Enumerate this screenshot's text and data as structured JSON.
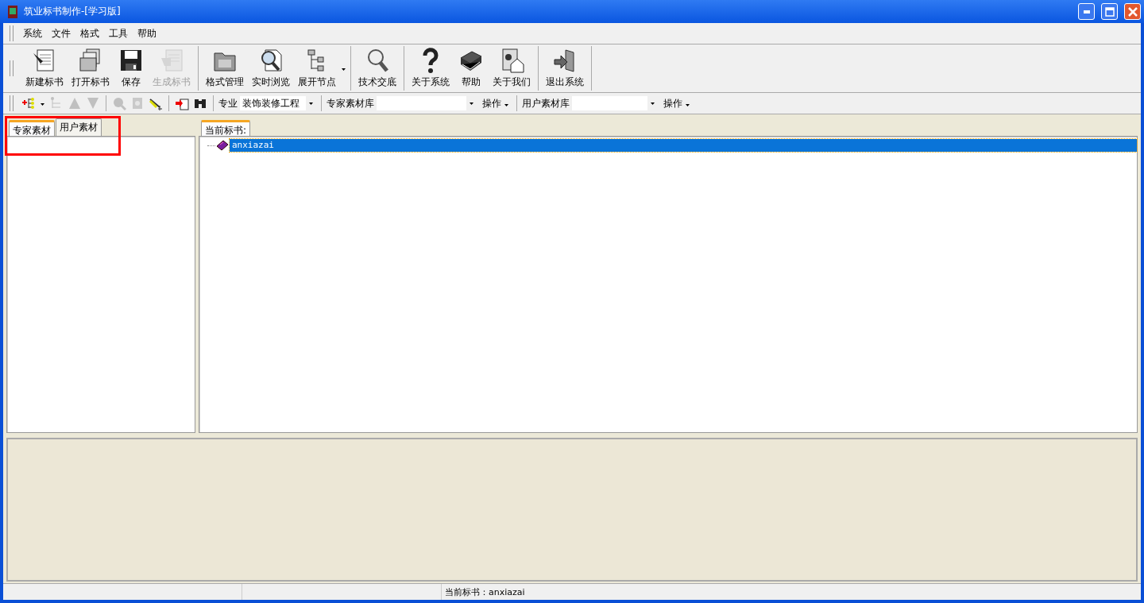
{
  "window": {
    "title": "筑业标书制作-[学习版]"
  },
  "menu": [
    "系统",
    "文件",
    "格式",
    "工具",
    "帮助"
  ],
  "toolbar": [
    [
      {
        "label": "新建标书",
        "disabled": false
      },
      {
        "label": "打开标书",
        "disabled": false
      },
      {
        "label": "保存",
        "disabled": false
      },
      {
        "label": "生成标书",
        "disabled": true
      }
    ],
    [
      {
        "label": "格式管理",
        "disabled": false
      },
      {
        "label": "实时浏览",
        "disabled": false
      },
      {
        "label": "展开节点",
        "disabled": false
      }
    ],
    [
      {
        "label": "技术交底",
        "disabled": false
      }
    ],
    [
      {
        "label": "关于系统",
        "disabled": false
      },
      {
        "label": "帮助",
        "disabled": false
      },
      {
        "label": "关于我们",
        "disabled": false
      }
    ],
    [
      {
        "label": "退出系统",
        "disabled": false
      }
    ]
  ],
  "toolbar2": {
    "icons": [
      {
        "disabled": false
      },
      {
        "disabled": true
      },
      {
        "disabled": true
      },
      {
        "disabled": true
      },
      {
        "disabled": true
      },
      {
        "disabled": true
      },
      {
        "disabled": false
      },
      {
        "disabled": false
      },
      {
        "disabled": false
      }
    ],
    "specialty_label": "专业",
    "specialty_value": "装饰装修工程",
    "expert_label": "专家素材库",
    "expert_action": "操作",
    "user_label": "用户素材库",
    "user_action": "操作"
  },
  "left_tabs": [
    {
      "label": "专家素材",
      "selected": true
    },
    {
      "label": "用户素材",
      "selected": false
    }
  ],
  "right_panel": {
    "tab": "当前标书:",
    "tree": [
      {
        "label": "anxiazai",
        "selected": true
      }
    ]
  },
  "status_bar": {
    "text": "当前标书：anxiazai"
  }
}
